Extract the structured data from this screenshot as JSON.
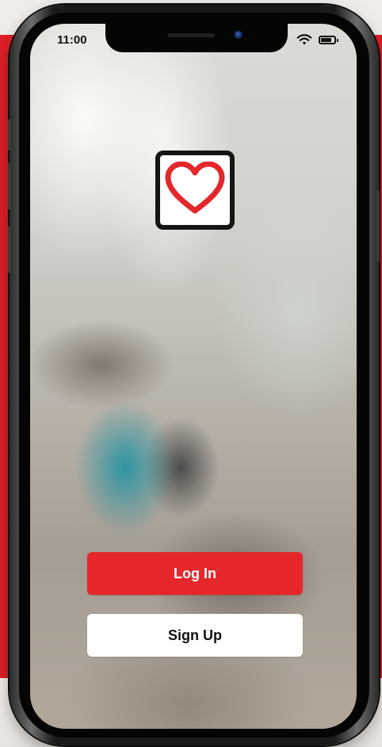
{
  "status_bar": {
    "time": "11:00",
    "wifi_icon": "wifi-icon",
    "battery_icon": "battery-icon"
  },
  "logo": {
    "icon": "heart-icon",
    "color": "#e5272b"
  },
  "actions": {
    "login_label": "Log In",
    "signup_label": "Sign Up"
  },
  "colors": {
    "accent": "#e5272b",
    "background_panel": "#e01f26",
    "signup_bg": "#ffffff"
  }
}
